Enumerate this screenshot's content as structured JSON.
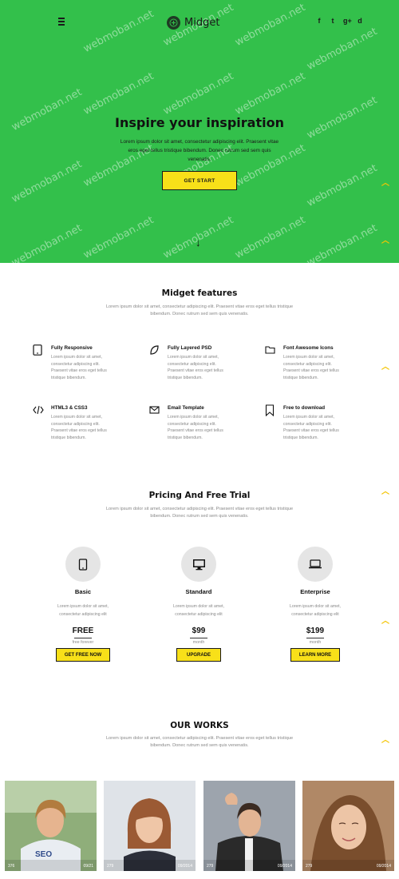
{
  "header": {
    "brand": "Midget",
    "social_icons": [
      "f",
      "t",
      "g+",
      "d"
    ]
  },
  "hero": {
    "title": "Inspire your inspiration",
    "text": "Lorem ipsum dolor sit amet, consectetur adipiscing elit. Praesent vitae eros eget tellus tristique bibendum. Donec rutrum sed sem quis venenatis.",
    "button": "GET START",
    "bg_color": "#33c04b",
    "accent_color": "#f8e019"
  },
  "watermark": "webmoban.net",
  "features": {
    "title": "Midget features",
    "subtitle": "Lorem ipsum dolor sit amet, consectetur adipiscing elit. Praesent vitae eros eget tellus tristique bibendum. Donec rutrum sed sem quis venenatis.",
    "items": [
      {
        "title": "Fully Responsive",
        "text": "Lorem ipsum dolor sit amet, consectetur adipiscing elit. Praesent vitae eros eget tellus tristique bibendum.",
        "icon": "tablet-icon"
      },
      {
        "title": "Fully Layered PSD",
        "text": "Lorem ipsum dolor sit amet, consectetur adipiscing elit. Praesent vitae eros eget tellus tristique bibendum.",
        "icon": "leaf-icon"
      },
      {
        "title": "Font Awesome Icons",
        "text": "Lorem ipsum dolor sit amet, consectetur adipiscing elit. Praesent vitae eros eget tellus tristique bibendum.",
        "icon": "folder-icon"
      },
      {
        "title": "HTML3 & CSS3",
        "text": "Lorem ipsum dolor sit amet, consectetur adipiscing elit. Praesent vitae eros eget tellus tristique bibendum.",
        "icon": "code-icon"
      },
      {
        "title": "Email Template",
        "text": "Lorem ipsum dolor sit amet, consectetur adipiscing elit. Praesent vitae eros eget tellus tristique bibendum.",
        "icon": "envelope-icon"
      },
      {
        "title": "Free to download",
        "text": "Lorem ipsum dolor sit amet, consectetur adipiscing elit. Praesent vitae eros eget tellus tristique bibendum.",
        "icon": "bookmark-icon"
      }
    ]
  },
  "pricing": {
    "title": "Pricing And Free Trial",
    "subtitle": "Lorem ipsum dolor sit amet, consectetur adipiscing elit. Praesent vitae eros eget tellus tristique bibendum. Donec rutrum sed sem quis venenatis.",
    "plans": [
      {
        "name": "Basic",
        "desc1": "Lorem ipsum dolor sit amet,",
        "desc2": "consectetur adipiscing elit",
        "price": "FREE",
        "period": "free forever",
        "button": "GET FREE NOW",
        "icon": "tablet-icon"
      },
      {
        "name": "Standard",
        "desc1": "Lorem ipsum dolor sit amet,",
        "desc2": "consectetur adipiscing elit",
        "price": "$99",
        "period": "month",
        "button": "UPGRADE",
        "icon": "monitor-icon"
      },
      {
        "name": "Enterprise",
        "desc1": "Lorem ipsum dolor sit amet,",
        "desc2": "consectetur adipiscing elit",
        "price": "$199",
        "period": "month",
        "button": "LEARN MORE",
        "icon": "laptop-icon"
      }
    ]
  },
  "works": {
    "title": "OUR WORKS",
    "subtitle": "Lorem ipsum dolor sit amet, consectetur adipiscing elit. Praesent vitae eros eget tellus tristique bibendum. Donec rutrum sed sem quis venenatis.",
    "items": [
      {
        "views": "376",
        "date": "09/21"
      },
      {
        "views": "279",
        "date": "09/2014"
      },
      {
        "views": "279",
        "date": "09/2014"
      },
      {
        "views": "279",
        "date": "09/2014"
      }
    ]
  }
}
